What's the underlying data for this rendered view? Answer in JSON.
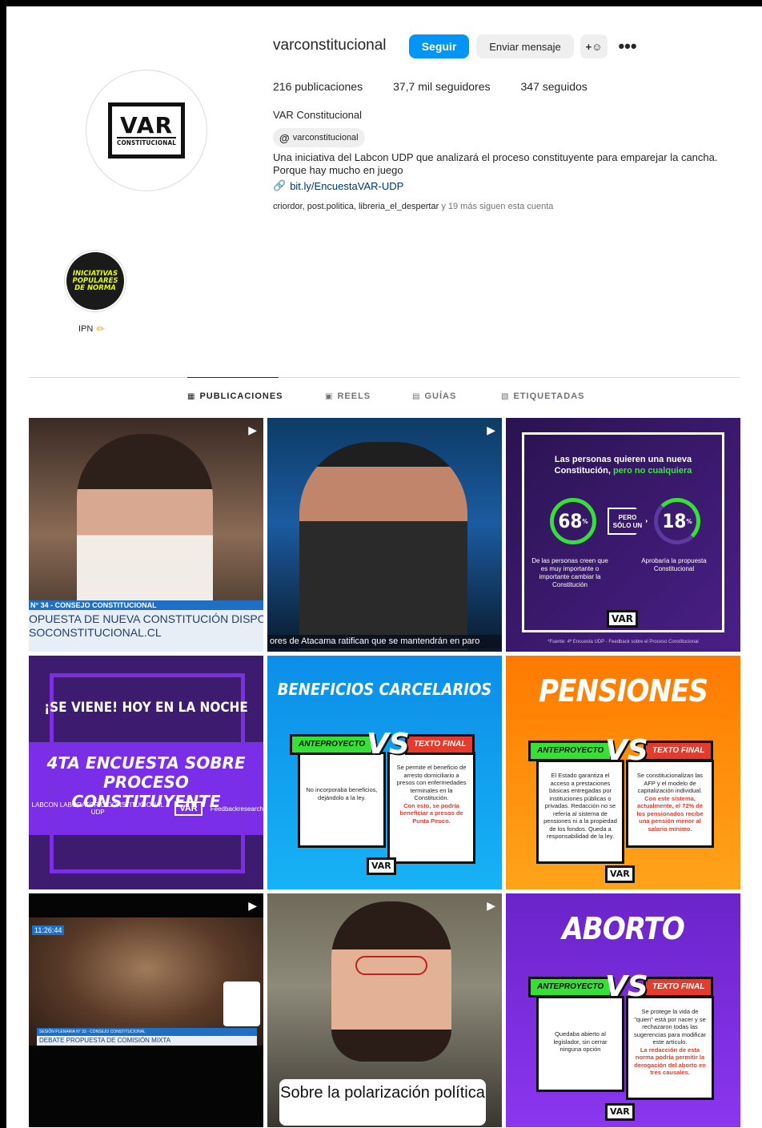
{
  "profile": {
    "username": "varconstitucional",
    "follow_label": "Seguir",
    "message_label": "Enviar mensaje",
    "add_label": "+☷",
    "more_label": "•••",
    "stats": {
      "posts": "216 publicaciones",
      "followers": "37,7 mil seguidores",
      "following": "347 seguidos"
    },
    "full_name": "VAR Constitucional",
    "threads_handle": "varconstitucional",
    "bio_line1": "Una iniciativa del Labcon UDP que analizará el proceso constituyente para emparejar la cancha.",
    "bio_line2": "Porque hay mucho en juego",
    "link": "bit.ly/EncuestaVAR-UDP",
    "followed_by": "criordor, post.politica, libreria_el_despertar",
    "followed_suffix": " y 19 más siguen esta cuenta",
    "avatar_big": "VAR",
    "avatar_small": "CONSTITUCIONAL"
  },
  "highlight": {
    "label": "IPN",
    "text": "INICIATIVAS POPULARES DE NORMA"
  },
  "tabs": [
    {
      "label": "PUBLICACIONES",
      "icon": "▦"
    },
    {
      "label": "REELS",
      "icon": "▣"
    },
    {
      "label": "GUÍAS",
      "icon": "▤"
    },
    {
      "label": "ETIQUETADAS",
      "icon": "▧"
    }
  ],
  "posts": {
    "p1": {
      "header": "N° 34 - CONSEJO CONSTITUCIONAL",
      "line1": "OPUESTA DE NUEVA CONSTITUCIÓN DISPONI",
      "line2": "SOCONSTITUCIONAL.CL"
    },
    "p2": {
      "ticker": "ores de Atacama ratifican que se mantendrán en paro"
    },
    "p3": {
      "title_a": "Las personas quieren una nueva",
      "title_b": "Constitución, ",
      "title_green": "pero no cualquiera",
      "pct1": "68",
      "pct2": "18",
      "arrow": "PERO SÓLO UN",
      "cap1": "De las personas creen que es muy importante o importante cambiar la Constitución",
      "cap2": "Aprobaría la propuesta Constitucional",
      "logo": "VAR",
      "source": "*Fuente: 4ª Encuesta UDP - Feedback sobre el Proceso Constitucional"
    },
    "p4": {
      "line1": "¡SE VIENE! HOY EN LA NOCHE",
      "line2": "4TA ENCUESTA SOBRE PROCESO CONSTITUYENTE",
      "logo_a": "LABCON LABORATORIO CONSTITUCIONAL UDP",
      "logo_b": "VAR",
      "logo_c": "Feedbackresearch"
    },
    "p5": {
      "title": "BENEFICIOS CARCELARIOS",
      "left_label": "ANTEPROYECTO",
      "right_label": "TEXTO FINAL",
      "vs": "VS",
      "left_text": "No incorporaba beneficios, dejándolo a la ley.",
      "right_text": "Se permite el beneficio de arresto domiciliario a presos con enfermedades terminales en la Constitución.",
      "right_red": "Con esto, se podría beneficiar a presos de Punta Peuco.",
      "logo": "VAR"
    },
    "p6": {
      "title": "PENSIONES",
      "left_label": "ANTEPROYECTO",
      "right_label": "TEXTO FINAL",
      "vs": "VS",
      "left_text": "El Estado garantiza el acceso a prestaciones básicas entregadas por instituciones públicas o privadas. Redacción no se refería al sistema de pensiones ni a la propiedad de los fondos. Queda a responsabilidad de la ley.",
      "right_text": "Se constitucionalizan las AFP y el modelo de capitalización individual.",
      "right_red": "Con este sistema, actualmente, el 72% de los pensionados recibe una pensión menor al salario mínimo.",
      "logo": "VAR"
    },
    "p7": {
      "time": "11:26:44",
      "bar1": "SESIÓN PLENARIA N° 33 - CONSEJO CONSTITUCIONAL",
      "bar2": "DEBATE PROPUESTA DE COMISIÓN MIXTA"
    },
    "p8": {
      "caption": "Sobre la polarización política"
    },
    "p9": {
      "title": "ABORTO",
      "left_label": "ANTEPROYECTO",
      "right_label": "TEXTO FINAL",
      "vs": "VS",
      "left_text": "Quedaba abierto al legislador, sin cerrar ninguna opción",
      "right_text": "Se protege la vida de \"quien\" está por nacer y se rechazaron todas las sugerencias para modificar este artículo.",
      "right_red": "La redacción de esta norma podría permitir la derogación del aborto en tres causales.",
      "logo": "VAR"
    }
  },
  "colors": {
    "accent": "#0095f6",
    "green": "#36e036",
    "red": "#e53b2c",
    "purple": "#7a2ee8",
    "orange": "#ff8a00",
    "blue": "#0c8ee8"
  }
}
